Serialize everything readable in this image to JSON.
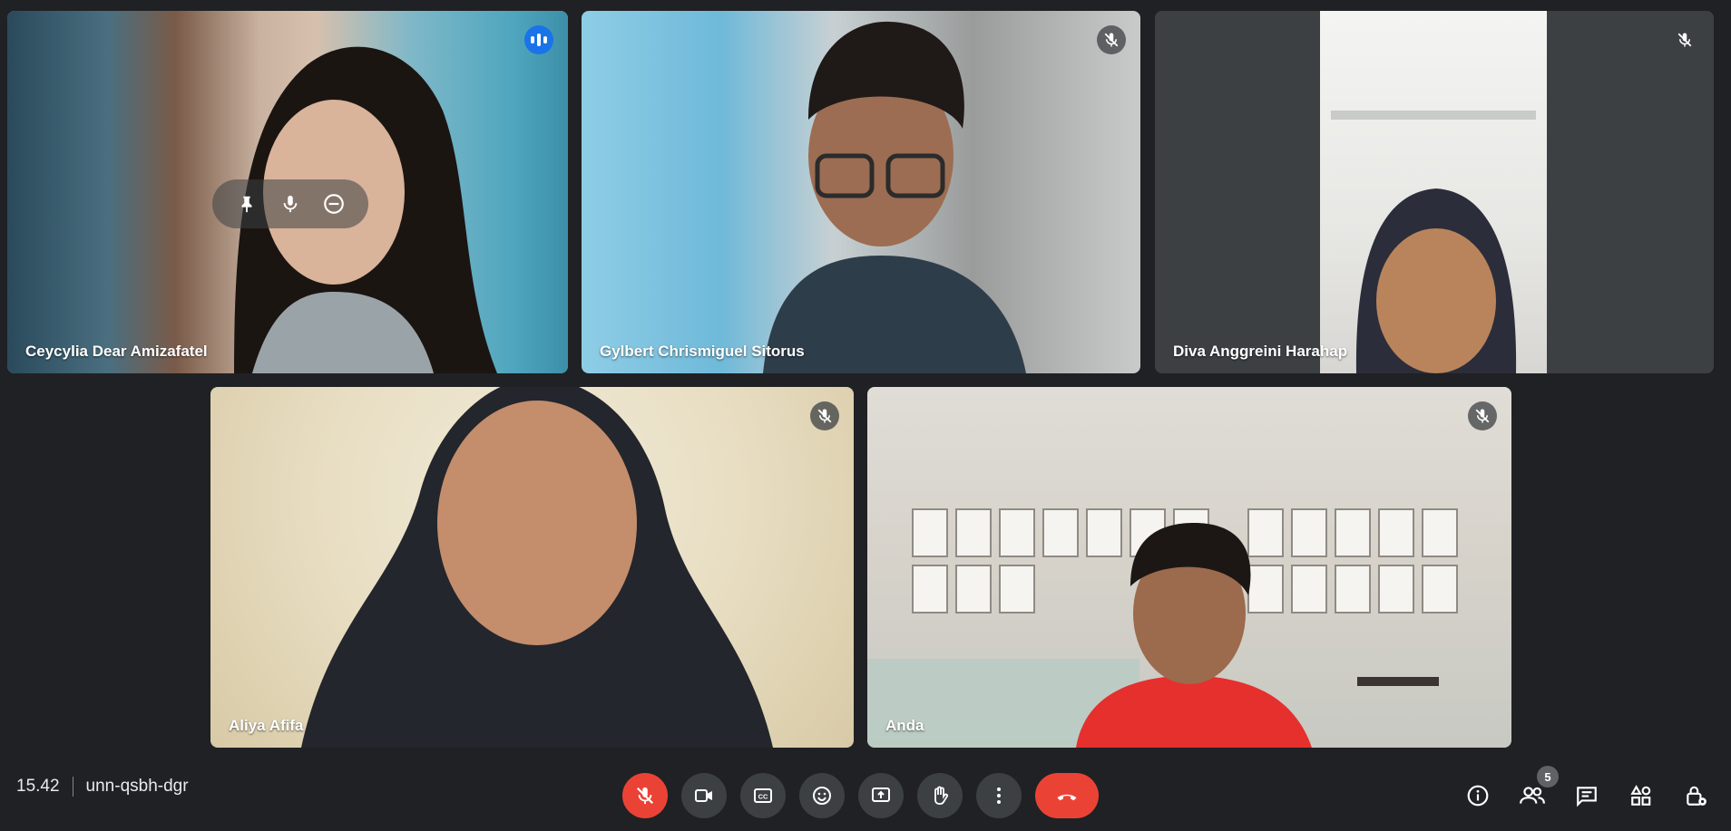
{
  "participants": [
    {
      "name": "Ceycylia Dear Amizafatel",
      "muted": false,
      "speaking": true
    },
    {
      "name": "Gylbert Chrismiguel Sitorus",
      "muted": true
    },
    {
      "name": "Diva Anggreini Harahap",
      "muted": true
    },
    {
      "name": "Aliya Afifa",
      "muted": true
    },
    {
      "name": "Anda",
      "muted": true
    }
  ],
  "meeting": {
    "time": "15.42",
    "code": "unn-qsbh-dgr"
  },
  "people_count": "5",
  "colors": {
    "background": "#202124",
    "control": "#3c4043",
    "danger": "#ea4335",
    "active_outline": "#8ab4f8",
    "speaking": "#1a73e8"
  },
  "icons": {
    "controls": [
      "mic-off-icon",
      "camera-icon",
      "captions-icon",
      "emoji-icon",
      "present-screen-icon",
      "raise-hand-icon",
      "more-options-icon",
      "end-call-icon"
    ],
    "right": [
      "info-icon",
      "people-icon",
      "chat-icon",
      "activities-icon",
      "host-controls-icon"
    ]
  }
}
